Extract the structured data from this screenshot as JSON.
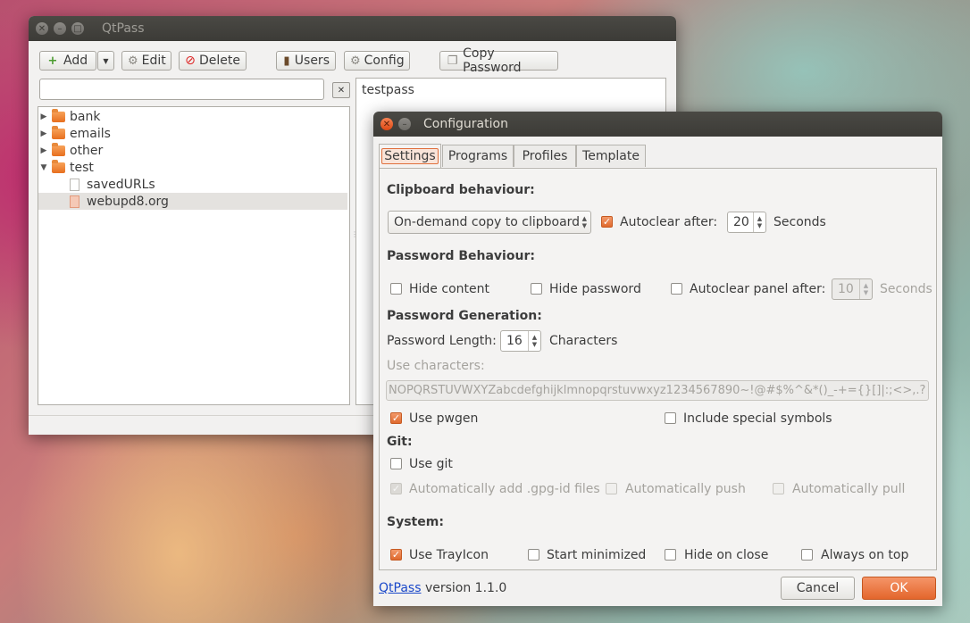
{
  "main_window": {
    "title": "QtPass",
    "toolbar": {
      "add": "Add",
      "edit": "Edit",
      "delete": "Delete",
      "users": "Users",
      "config": "Config",
      "copy_password": "Copy Password"
    },
    "search": {
      "value": "",
      "placeholder": ""
    },
    "tree": [
      {
        "label": "bank",
        "type": "folder",
        "expanded": false
      },
      {
        "label": "emails",
        "type": "folder",
        "expanded": false
      },
      {
        "label": "other",
        "type": "folder",
        "expanded": false
      },
      {
        "label": "test",
        "type": "folder",
        "expanded": true
      },
      {
        "label": "savedURLs",
        "type": "file"
      },
      {
        "label": "webupd8.org",
        "type": "file",
        "selected": true
      }
    ],
    "content_text": "testpass"
  },
  "config_dialog": {
    "title": "Configuration",
    "tabs": [
      "Settings",
      "Programs",
      "Profiles",
      "Template"
    ],
    "clipboard": {
      "heading": "Clipboard behaviour:",
      "mode": "On-demand copy to clipboard",
      "autoclear_label": "Autoclear after:",
      "autoclear_checked": true,
      "autoclear_value": "20",
      "autoclear_unit": "Seconds"
    },
    "password_behaviour": {
      "heading": "Password Behaviour:",
      "hide_content": "Hide content",
      "hide_password": "Hide password",
      "autoclear_panel": "Autoclear panel after:",
      "autoclear_panel_value": "10",
      "autoclear_panel_unit": "Seconds"
    },
    "password_generation": {
      "heading": "Password Generation:",
      "length_label": "Password Length:",
      "length_value": "16",
      "length_unit": "Characters",
      "use_characters_label": "Use characters:",
      "characters": "NOPQRSTUVWXYZabcdefghijklmnopqrstuvwxyz1234567890~!@#$%^&*()_-+={}[]|:;<>,.?",
      "use_pwgen": "Use pwgen",
      "use_pwgen_checked": true,
      "include_special": "Include special symbols"
    },
    "git": {
      "heading": "Git:",
      "use_git": "Use git",
      "auto_add": "Automatically add .gpg-id files",
      "auto_push": "Automatically push",
      "auto_pull": "Automatically pull"
    },
    "system": {
      "heading": "System:",
      "use_trayicon": "Use TrayIcon",
      "use_trayicon_checked": true,
      "start_minimized": "Start minimized",
      "hide_on_close": "Hide on close",
      "always_on_top": "Always on top"
    },
    "footer": {
      "app_link": "QtPass",
      "version_text": "version 1.1.0",
      "cancel": "Cancel",
      "ok": "OK"
    }
  },
  "colors": {
    "accent": "#e9713a",
    "titlebar": "#3c3b37",
    "link": "#1a48c9"
  }
}
